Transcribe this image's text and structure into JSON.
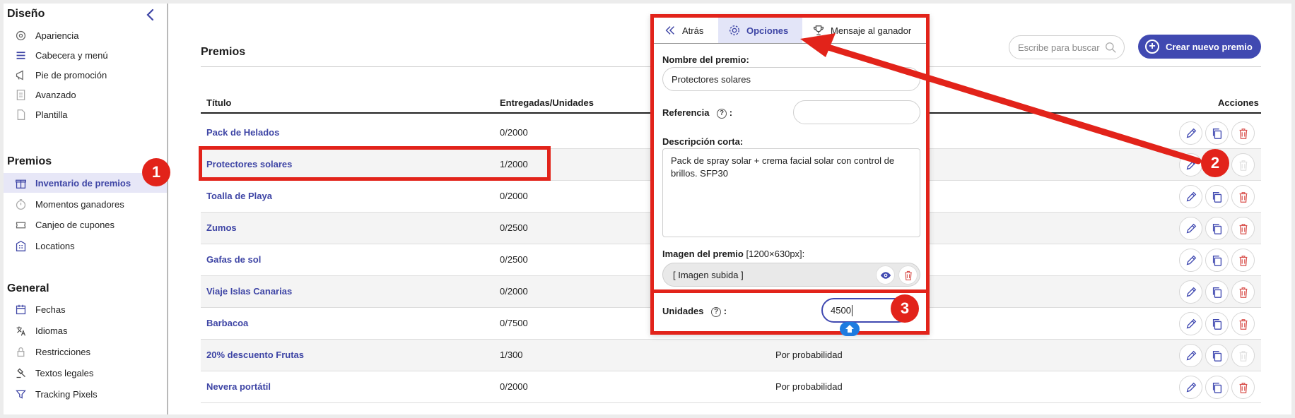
{
  "sidebar": {
    "section_design": "Diseño",
    "design_items": [
      {
        "label": "Apariencia",
        "icon": "palette-gear-icon"
      },
      {
        "label": "Cabecera y menú",
        "icon": "menu-lines-icon"
      },
      {
        "label": "Pie de promoción",
        "icon": "megaphone-icon"
      },
      {
        "label": "Avanzado",
        "icon": "document-lines-icon"
      },
      {
        "label": "Plantilla",
        "icon": "document-icon"
      }
    ],
    "section_prizes": "Premios",
    "prize_items": [
      {
        "label": "Inventario de premios",
        "icon": "gift-icon",
        "active": true
      },
      {
        "label": "Momentos ganadores",
        "icon": "stopwatch-icon"
      },
      {
        "label": "Canjeo de cupones",
        "icon": "coupon-icon"
      },
      {
        "label": "Locations",
        "icon": "building-icon"
      }
    ],
    "section_general": "General",
    "general_items": [
      {
        "label": "Fechas",
        "icon": "calendar-icon"
      },
      {
        "label": "Idiomas",
        "icon": "translate-icon"
      },
      {
        "label": "Restricciones",
        "icon": "lock-icon"
      },
      {
        "label": "Textos legales",
        "icon": "gavel-icon"
      },
      {
        "label": "Tracking Pixels",
        "icon": "filter-icon"
      }
    ]
  },
  "main": {
    "title": "Premios",
    "search_placeholder": "Escribe para buscar",
    "create_button": "Crear nuevo premio",
    "columns": {
      "title": "Título",
      "units": "Entregadas/Unidades",
      "actions": "Acciones"
    },
    "rows": [
      {
        "title": "Pack de Helados",
        "units": "0/2000",
        "mode": "",
        "del_enabled": true
      },
      {
        "title": "Protectores solares",
        "units": "1/2000",
        "mode": "",
        "del_enabled": false
      },
      {
        "title": "Toalla de Playa",
        "units": "0/2000",
        "mode": "",
        "del_enabled": true
      },
      {
        "title": "Zumos",
        "units": "0/2500",
        "mode": "",
        "del_enabled": true
      },
      {
        "title": "Gafas de sol",
        "units": "0/2500",
        "mode": "",
        "del_enabled": true
      },
      {
        "title": "Viaje Islas Canarias",
        "units": "0/2000",
        "mode": "",
        "del_enabled": true
      },
      {
        "title": "Barbacoa",
        "units": "0/7500",
        "mode": "",
        "del_enabled": true
      },
      {
        "title": "20% descuento Frutas",
        "units": "1/300",
        "mode": "Por probabilidad",
        "del_enabled": false
      },
      {
        "title": "Nevera portátil",
        "units": "0/2000",
        "mode": "Por probabilidad",
        "del_enabled": true
      }
    ]
  },
  "panel": {
    "tabs": [
      {
        "label": "Atrás",
        "icon": "double-chevron-left-icon"
      },
      {
        "label": "Opciones",
        "icon": "gear-icon",
        "active": true
      },
      {
        "label": "Mensaje al ganador",
        "icon": "trophy-icon"
      }
    ],
    "name_label": "Nombre del premio:",
    "name_value": "Protectores solares",
    "ref_label": "Referencia",
    "ref_value": "",
    "desc_label": "Descripción corta:",
    "desc_value": "Pack de spray solar + crema facial solar con control de brillos. SFP30",
    "image_label": "Imagen del premio",
    "image_size": "[1200×630px]:",
    "image_value": "[ Imagen subida ]",
    "units_label": "Unidades",
    "units_value": "4500",
    "help_symbol": "?",
    "colon": ":"
  },
  "annotations": {
    "badge1": "1",
    "badge2": "2",
    "badge3": "3",
    "color": "#e2231a"
  },
  "colors": {
    "accent": "#4049b1",
    "link": "#3e45a5",
    "danger": "#d9534f"
  }
}
